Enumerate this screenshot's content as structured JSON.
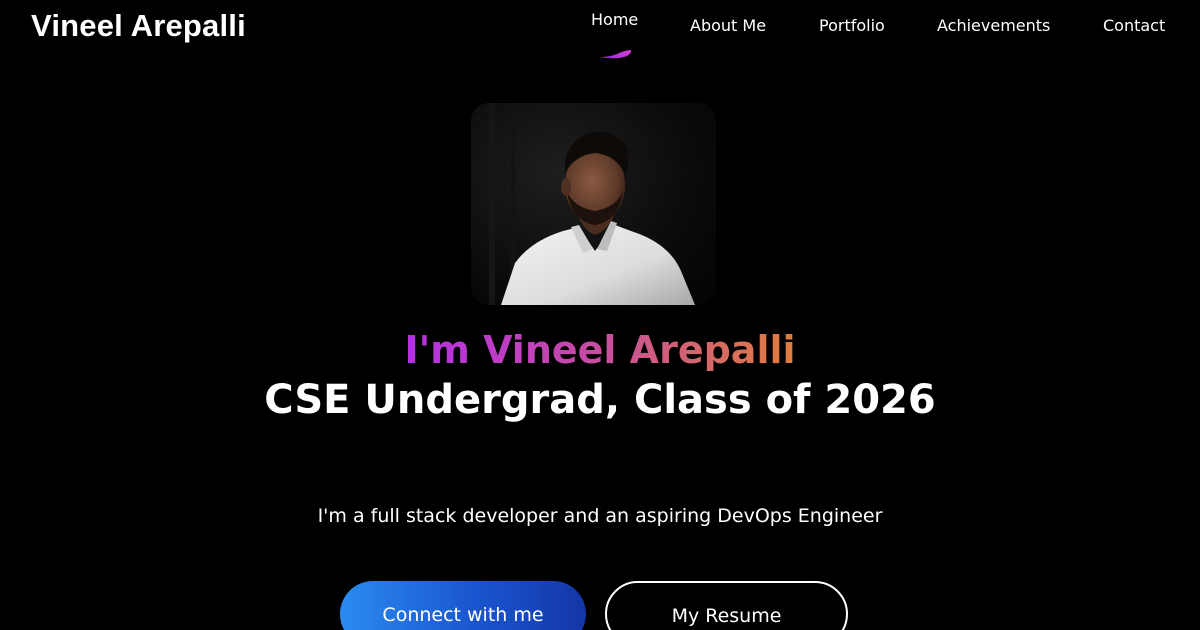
{
  "brand": {
    "name": "Vineel Arepalli"
  },
  "nav": {
    "items": [
      {
        "label": "Home",
        "active": true
      },
      {
        "label": "About Me",
        "active": false
      },
      {
        "label": "Portfolio",
        "active": false
      },
      {
        "label": "Achievements",
        "active": false
      },
      {
        "label": "Contact",
        "active": false
      }
    ]
  },
  "hero": {
    "greeting": "I'm Vineel Arepalli",
    "role": "CSE Undergrad, Class of 2026",
    "tagline": "I'm a full stack developer and an aspiring DevOps Engineer",
    "primary_button": "Connect with me",
    "secondary_button": "My Resume",
    "avatar_alt": "profile-photo"
  },
  "colors": {
    "background": "#000000",
    "text": "#ffffff",
    "gradient_start": "#b62ee6",
    "gradient_end": "#e07d3c",
    "button_primary_start": "#2b8bf0",
    "button_primary_end": "#1436a8"
  }
}
